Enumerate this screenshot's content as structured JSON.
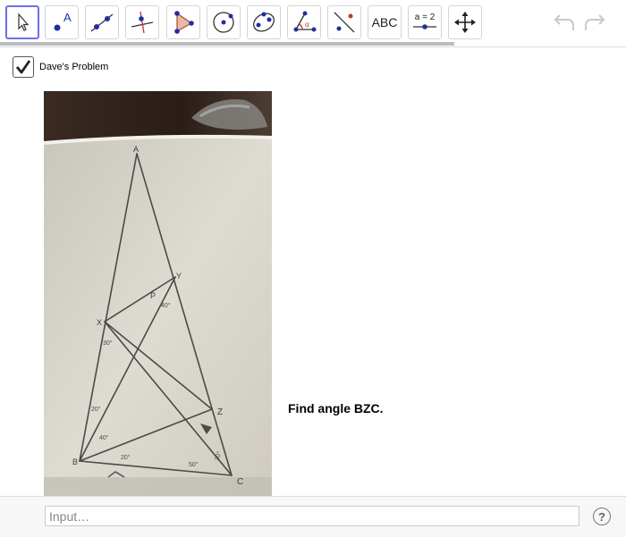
{
  "toolbar": {
    "tools": [
      {
        "name": "move-tool",
        "selected": true
      },
      {
        "name": "point-tool",
        "label": "A"
      },
      {
        "name": "line-tool"
      },
      {
        "name": "perpendicular-line-tool"
      },
      {
        "name": "polygon-tool"
      },
      {
        "name": "circle-tool"
      },
      {
        "name": "conic-tool"
      },
      {
        "name": "angle-tool",
        "label": "α"
      },
      {
        "name": "reflect-tool"
      },
      {
        "name": "text-tool",
        "label": "ABC"
      },
      {
        "name": "slider-tool",
        "label": "a = 2"
      },
      {
        "name": "move-graphics-view-tool"
      }
    ]
  },
  "checkbox": {
    "label": "Dave's Problem",
    "checked": true
  },
  "photo": {
    "vertex_labels": [
      "A",
      "Y",
      "X",
      "P",
      "Z",
      "B",
      "C"
    ],
    "angle_labels": [
      "40°",
      "30°",
      "20°",
      "40°",
      "20°",
      "50°",
      "30°"
    ]
  },
  "prompt": {
    "text": "Find angle BZC."
  },
  "input": {
    "placeholder": "Input…",
    "value": ""
  },
  "help": {
    "label": "?"
  }
}
